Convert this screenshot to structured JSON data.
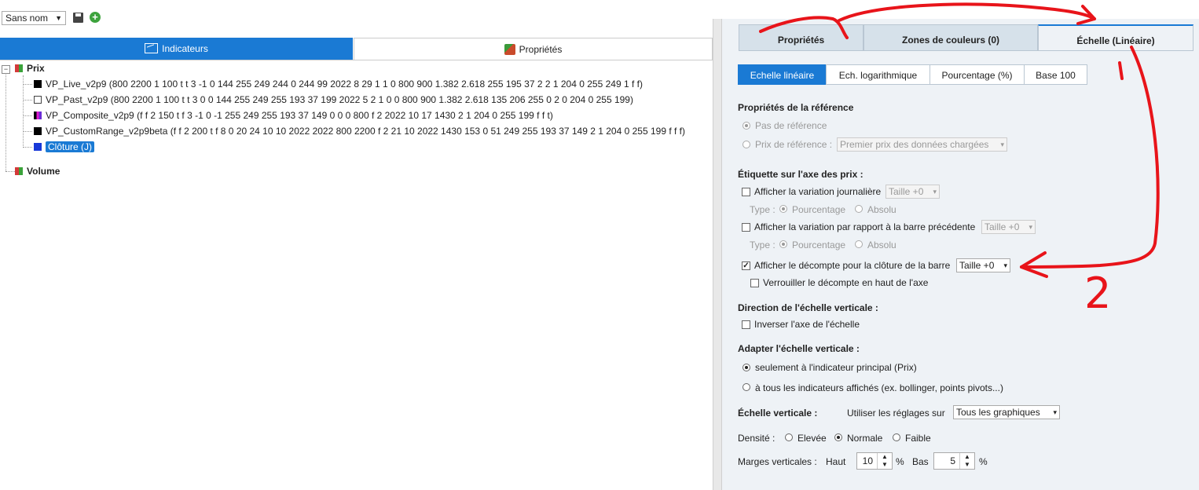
{
  "toolbar": {
    "template_name": "Sans nom"
  },
  "left_tabs": {
    "indicators": "Indicateurs",
    "properties": "Propriétés"
  },
  "tree": {
    "price": "Prix",
    "items": [
      "VP_Live_v2p9 (800 2200 1 100 t t 3 -1 0 144 255 249 244 0 244 99 2022 8 29 1 1 0 800 900 1.382 2.618 255 195 37 2 2 1 204 0 255 249 1 f f)",
      "VP_Past_v2p9 (800 2200 1 100 t t 3 0 0 144 255 249 255 193 37 199 2022 5 2 1 0 0 800 900 1.382 2.618 135 206 255 0 2 0 204 0 255 199)",
      "VP_Composite_v2p9 (f f 2 150 t f 3 -1 0 -1 255 249 255 193 37 149 0 0 0 800 f 2 2022 10 17 1430 2 1 204 0 255 199 f f t)",
      "VP_CustomRange_v2p9beta (f f 2 200 t f 8 0 20 24 10 10 2022 2022 800 2200 f 2 21 10 2022 1430 153 0 51 249 255 193 37 149 2 1 204 0 255 199 f f f)"
    ],
    "selected": "Clôture (J)",
    "volume": "Volume"
  },
  "right_tabs": {
    "properties": "Propriétés",
    "color_zones": "Zones de couleurs (0)",
    "scale": "Échelle (Linéaire)"
  },
  "scale_types": [
    "Echelle linéaire",
    "Ech. logarithmique",
    "Pourcentage (%)",
    "Base 100"
  ],
  "reference": {
    "title": "Propriétés de la référence",
    "no_ref": "Pas de référence",
    "ref_price": "Prix de référence :",
    "ref_select": "Premier prix des données chargées"
  },
  "axis_label": {
    "title": "Étiquette sur l'axe des prix :",
    "daily_var": "Afficher la variation journalière",
    "size_select": "Taille +0",
    "type_label": "Type :",
    "percent": "Pourcentage",
    "absolute": "Absolu",
    "prev_bar_var": "Afficher la variation par rapport à la barre précédente",
    "countdown": "Afficher le décompte pour la clôture de la barre",
    "lock_countdown": "Verrouiller le décompte en haut de l'axe"
  },
  "direction": {
    "title": "Direction de l'échelle verticale :",
    "invert": "Inverser l'axe de l'échelle"
  },
  "fit": {
    "title": "Adapter l'échelle verticale :",
    "main_only": "seulement à l'indicateur principal (Prix)",
    "all": "à tous les indicateurs affichés (ex. bollinger, points pivots...)"
  },
  "vscale": {
    "title": "Échelle verticale :",
    "use_settings": "Utiliser les réglages sur",
    "select": "Tous les graphiques"
  },
  "density": {
    "label": "Densité :",
    "high": "Elevée",
    "normal": "Normale",
    "low": "Faible"
  },
  "margins": {
    "label": "Marges verticales :",
    "top_label": "Haut",
    "top_value": "10",
    "bottom_label": "Bas",
    "bottom_value": "5",
    "unit": "%"
  },
  "annotation": {
    "number": "2"
  },
  "colors": {
    "accent": "#1a7ad4",
    "annotation": "#e8141a"
  }
}
